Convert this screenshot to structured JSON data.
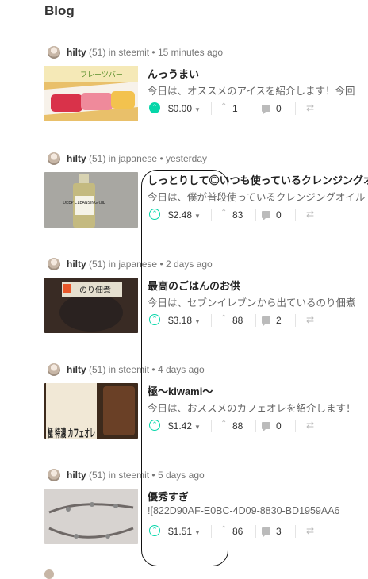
{
  "page": {
    "title": "Blog"
  },
  "posts": [
    {
      "author": "hilty",
      "rep": "(51)",
      "in_text": "in",
      "category": "steemit",
      "time": "15 minutes ago",
      "title": "んっうまい",
      "body": "今日は、オススメのアイスを紹介します！今回",
      "payout": "$0.00",
      "votes": "1",
      "comments": "0",
      "voted": true,
      "thumb_text": "フレーツバー"
    },
    {
      "author": "hilty",
      "rep": "(51)",
      "in_text": "in",
      "category": "japanese",
      "time": "yesterday",
      "title": "しっとりして◎いつも使っているクレンジングオイル",
      "body": "今日は、僕が普段使っているクレンジングオイル",
      "payout": "$2.48",
      "votes": "83",
      "comments": "0",
      "voted": false,
      "thumb_text": "DEEP CLEANSING OIL"
    },
    {
      "author": "hilty",
      "rep": "(51)",
      "in_text": "in",
      "category": "japanese",
      "time": "2 days ago",
      "title": "最高のごはんのお供",
      "body": "今日は、セブンイレブンから出ているのり佃煮",
      "payout": "$3.18",
      "votes": "88",
      "comments": "2",
      "voted": false,
      "thumb_text": "のり佃煮"
    },
    {
      "author": "hilty",
      "rep": "(51)",
      "in_text": "in",
      "category": "steemit",
      "time": "4 days ago",
      "title": "極〜kiwami〜",
      "body": "今日は、おススメのカフェオレを紹介します！",
      "payout": "$1.42",
      "votes": "88",
      "comments": "0",
      "voted": false,
      "thumb_text": "極 特濃 カフェオレ"
    },
    {
      "author": "hilty",
      "rep": "(51)",
      "in_text": "in",
      "category": "steemit",
      "time": "5 days ago",
      "title": "優秀すぎ",
      "body": "![822D90AF-E0BC-4D09-8830-BD1959AA6",
      "payout": "$1.51",
      "votes": "86",
      "comments": "3",
      "voted": false,
      "thumb_text": ""
    }
  ],
  "icons": {
    "upvote": "chevron-up-circle-icon",
    "payout_dropdown": "caret-down-icon",
    "votes": "chevron-up-icon",
    "comments": "comment-icon",
    "resteem": "resteem-icon"
  },
  "colors": {
    "accent": "#06d6a9",
    "annotation": "#111111"
  }
}
